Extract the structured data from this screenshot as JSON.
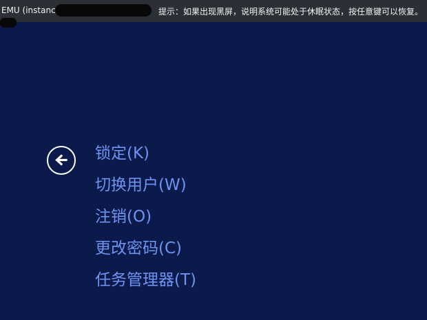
{
  "topbar": {
    "instance_text": "EMU (instance",
    "hint_text": "提示：如果出现黑屏，说明系统可能处于休眠状态，按任意键可以恢复。"
  },
  "back_button": {
    "icon": "arrow-left-icon"
  },
  "menu": {
    "items": [
      {
        "label": "锁定(K)"
      },
      {
        "label": "切换用户(W)"
      },
      {
        "label": "注销(O)"
      },
      {
        "label": "更改密码(C)"
      },
      {
        "label": "任务管理器(T)"
      }
    ]
  },
  "colors": {
    "background": "#0b1a4a",
    "topbar": "#2b2f36",
    "menu_text": "#6f93f0",
    "icon": "#ffffff"
  }
}
